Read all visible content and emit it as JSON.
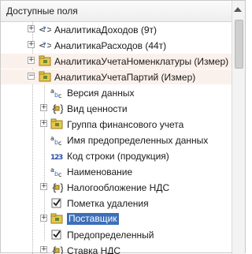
{
  "header": {
    "title": "Доступные поля"
  },
  "tree": {
    "top_items": [
      {
        "label": "АналитикаДоходов (9т)",
        "icon": "link-icon"
      },
      {
        "label": "АналитикаРасходов (44т)",
        "icon": "link-icon"
      },
      {
        "label": "АналитикаУчетаНоменклатуры (Измер)",
        "icon": "folder-key-icon"
      },
      {
        "label": "АналитикаУчетаПартий (Измер)",
        "icon": "folder-key-icon"
      }
    ],
    "children": [
      {
        "label": "Версия данных",
        "icon": "string-icon"
      },
      {
        "label": "Вид ценности",
        "icon": "enum-icon"
      },
      {
        "label": "Группа финансового учета",
        "icon": "folder-key-icon"
      },
      {
        "label": "Имя предопределенных данных",
        "icon": "string-icon"
      },
      {
        "label": "Код строки (продукция)",
        "icon": "number-icon"
      },
      {
        "label": "Наименование",
        "icon": "string-icon"
      },
      {
        "label": "Налогообложение НДС",
        "icon": "enum-icon"
      },
      {
        "label": "Пометка удаления",
        "icon": "checkbox-icon"
      },
      {
        "label": "Поставщик",
        "icon": "folder-key-icon"
      },
      {
        "label": "Предопределенный",
        "icon": "checkbox-icon"
      },
      {
        "label": "Ставка НДС",
        "icon": "enum-icon"
      }
    ],
    "colors": {
      "selection": "#3d6fb8",
      "shaded_row": "#fbf1ec"
    }
  }
}
